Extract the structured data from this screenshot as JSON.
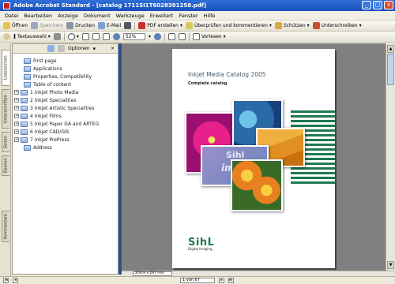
{
  "window": {
    "title": "Adobe Acrobat Standard - [catalog 1711SI1T6028391258.pdf]",
    "controls": [
      "_",
      "□",
      "×"
    ]
  },
  "menu": [
    "Datei",
    "Bearbeiten",
    "Anzeige",
    "Dokument",
    "Werkzeuge",
    "Erweitert",
    "Fenster",
    "Hilfe"
  ],
  "toolbar1": {
    "open": "Öffnen",
    "save": "Speichern",
    "print": "Drucken",
    "email": "E-Mail",
    "pdf": "PDF erstellen",
    "review": "Überprüfen und kommentieren",
    "secure": "Schützen",
    "sign": "Unterschreiben"
  },
  "toolbar2": {
    "text_tool": "Textauswahl",
    "zoom": "52%",
    "read": "Vorlesen"
  },
  "side_tabs": [
    "Lesezeichen",
    "Unterschriften",
    "Seiten",
    "Ebenen",
    "Kommentare"
  ],
  "panel": {
    "options": "Optionen",
    "close": "×",
    "bookmarks": [
      {
        "label": "First page",
        "expandable": false
      },
      {
        "label": "Applications",
        "expandable": false
      },
      {
        "label": "Properties, Compatibility",
        "expandable": false
      },
      {
        "label": "Table of content",
        "expandable": false
      },
      {
        "label": "1 Inkjet Photo Media",
        "expandable": true
      },
      {
        "label": "2 Inkjet Specialities",
        "expandable": true
      },
      {
        "label": "3 Inkjet Artistic Specialities",
        "expandable": true
      },
      {
        "label": "4 Inkjet Films",
        "expandable": true
      },
      {
        "label": "5 Inkjet Paper GA and ARTEG",
        "expandable": true
      },
      {
        "label": "6 Inkjet CAD/GIS",
        "expandable": true
      },
      {
        "label": "7 Inkjet PrePress",
        "expandable": true
      },
      {
        "label": "Address",
        "expandable": false
      }
    ]
  },
  "document": {
    "title": "Inkjet Media Catalog 2005",
    "subtitle": "Complete catalog",
    "overlay_brand": "Sihl",
    "overlay_text": "images",
    "logo_brand": "SihL",
    "logo_tag": "Digital Imaging"
  },
  "hscroll": {
    "page_size": "209,9 x 297 mm"
  },
  "status": {
    "page": "1 von 67"
  },
  "colors": {
    "titlebar": "#1b4fb8",
    "doc_bg": "#808080",
    "sihl_green": "#1e7a4f"
  }
}
